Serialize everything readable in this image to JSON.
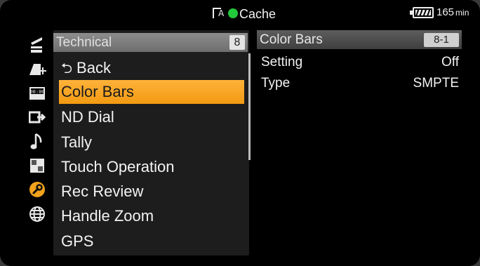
{
  "status_bar": {
    "media_letter": "A",
    "title": "Cache",
    "battery_minutes": "165",
    "battery_unit": "min",
    "colors": {
      "rec_dot": "#22c93a"
    }
  },
  "sidebar": {
    "icons": [
      "camera-settings-icon",
      "paint-icon",
      "timecode-icon",
      "output-icon",
      "audio-note-icon",
      "thumbnail-icon",
      "technical-wrench-icon",
      "network-globe-icon"
    ],
    "active_icon": "technical-wrench-icon",
    "colors": {
      "active": "#f2a21c"
    }
  },
  "menu": {
    "header": {
      "title": "Technical",
      "page": "8"
    },
    "items": [
      {
        "label": "Back",
        "icon": "back-arrow-icon"
      },
      {
        "label": "Color Bars",
        "selected": true
      },
      {
        "label": "ND Dial"
      },
      {
        "label": "Tally"
      },
      {
        "label": "Touch Operation"
      },
      {
        "label": "Rec Review"
      },
      {
        "label": "Handle Zoom"
      },
      {
        "label": "GPS"
      }
    ],
    "colors": {
      "selection": "#f5a018"
    }
  },
  "detail": {
    "header": {
      "title": "Color Bars",
      "index": "8-1"
    },
    "rows": [
      {
        "name": "Setting",
        "value": "Off"
      },
      {
        "name": "Type",
        "value": "SMPTE"
      }
    ]
  }
}
